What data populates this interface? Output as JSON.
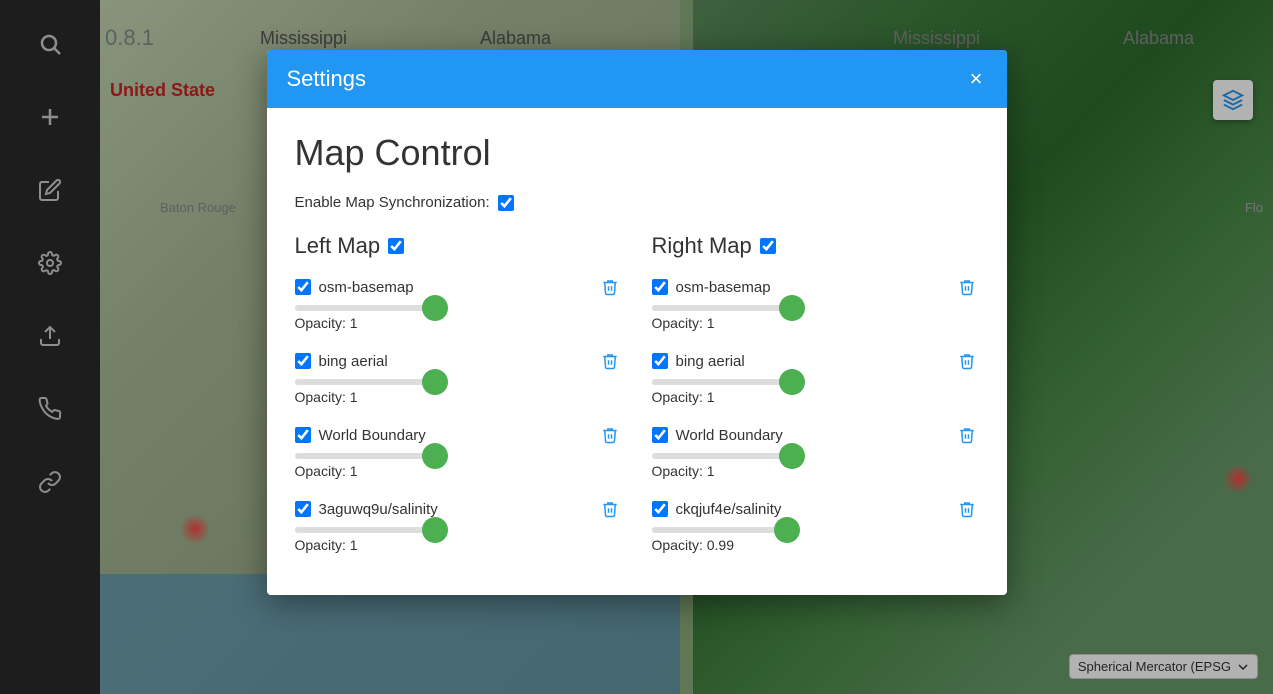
{
  "app": {
    "version": "0.8.1"
  },
  "sidebar": {
    "buttons": [
      {
        "icon": "🔍",
        "name": "search"
      },
      {
        "icon": "+",
        "name": "add"
      },
      {
        "icon": "✏️",
        "name": "edit"
      },
      {
        "icon": "⚙️",
        "name": "settings"
      },
      {
        "icon": "↗",
        "name": "share"
      },
      {
        "icon": "📞",
        "name": "contact"
      },
      {
        "icon": "🔗",
        "name": "links"
      }
    ]
  },
  "map": {
    "left_labels": {
      "state1": "Mississippi",
      "state2": "Alabama",
      "city": "Baton Rouge"
    },
    "right_labels": {
      "state1": "Mississippi",
      "state2": "Alabama",
      "flo": "Flo"
    },
    "us_label": "United State",
    "epsg_label": "Spherical Mercator (EPSG",
    "epsg_code": "..."
  },
  "modal": {
    "title": "Settings",
    "close_label": "×",
    "section_title": "Map Control",
    "sync_label": "Enable Map Synchronization:",
    "sync_checked": true,
    "left_map": {
      "label": "Left Map",
      "checked": true,
      "layers": [
        {
          "name": "osm-basemap",
          "checked": true,
          "opacity": 1,
          "opacity_label": "Opacity: 1",
          "fill_width": "100%"
        },
        {
          "name": "bing aerial",
          "checked": true,
          "opacity": 1,
          "opacity_label": "Opacity: 1",
          "fill_width": "100%"
        },
        {
          "name": "World Boundary",
          "checked": true,
          "opacity": 1,
          "opacity_label": "Opacity: 1",
          "fill_width": "100%"
        },
        {
          "name": "3aguwq9u/salinity",
          "checked": true,
          "opacity": 1,
          "opacity_label": "Opacity: 1",
          "fill_width": "100%"
        }
      ]
    },
    "right_map": {
      "label": "Right Map",
      "checked": true,
      "layers": [
        {
          "name": "osm-basemap",
          "checked": true,
          "opacity": 1,
          "opacity_label": "Opacity: 1",
          "fill_width": "100%"
        },
        {
          "name": "bing aerial",
          "checked": true,
          "opacity": 1,
          "opacity_label": "Opacity: 1",
          "fill_width": "100%"
        },
        {
          "name": "World Boundary",
          "checked": true,
          "opacity": 1,
          "opacity_label": "Opacity: 1",
          "fill_width": "100%"
        },
        {
          "name": "ckqjuf4e/salinity",
          "checked": true,
          "opacity": 0.99,
          "opacity_label": "Opacity: 0.99",
          "fill_width": "99%"
        }
      ]
    }
  }
}
